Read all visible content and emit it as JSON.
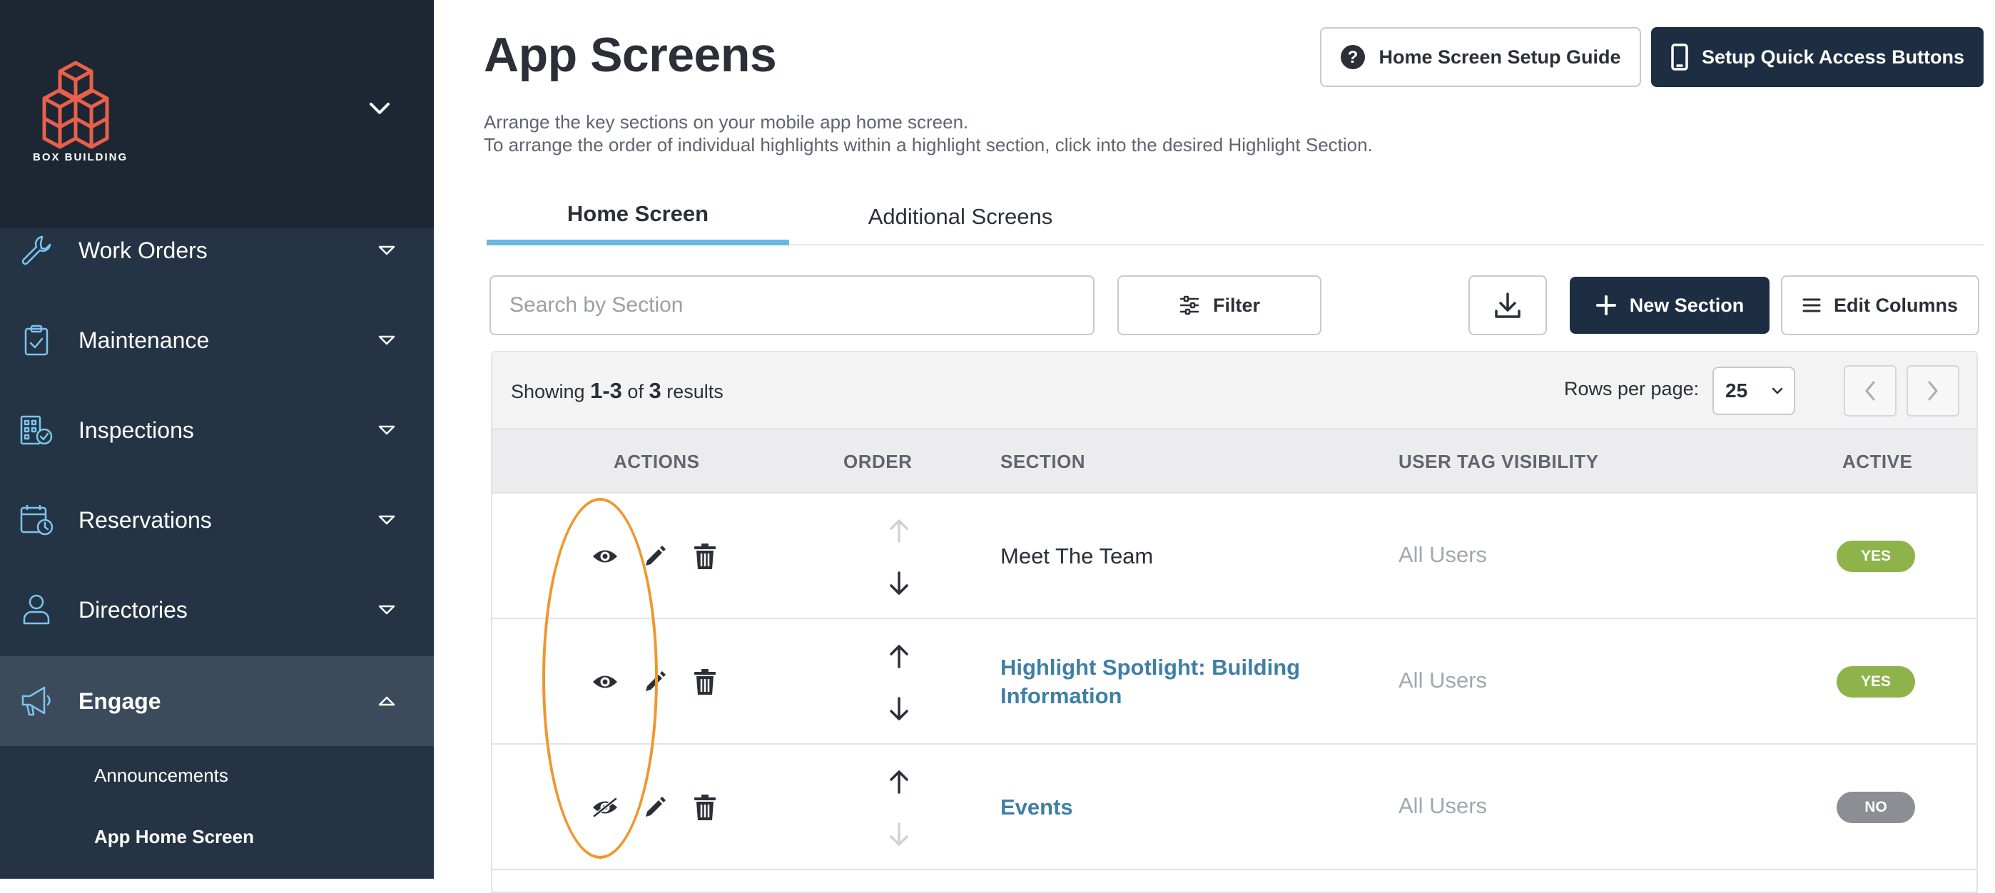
{
  "brand": {
    "name": "BOX BUILDING"
  },
  "sidebar": {
    "items": [
      {
        "label": "Work Orders",
        "icon": "wrench-icon"
      },
      {
        "label": "Maintenance",
        "icon": "clipboard-check-icon"
      },
      {
        "label": "Inspections",
        "icon": "building-check-icon"
      },
      {
        "label": "Reservations",
        "icon": "calendar-clock-icon"
      },
      {
        "label": "Directories",
        "icon": "person-icon"
      },
      {
        "label": "Engage",
        "icon": "megaphone-icon"
      }
    ],
    "subitems": [
      {
        "label": "Announcements"
      },
      {
        "label": "App Home Screen"
      }
    ]
  },
  "header": {
    "title": "App Screens",
    "description_line1": "Arrange the key sections on your mobile app home screen.",
    "description_line2": "To arrange the order of individual highlights within a highlight section, click into the desired Highlight Section.",
    "guide_button": "Home Screen Setup Guide",
    "quick_access_button": "Setup Quick Access Buttons"
  },
  "tabs": [
    {
      "label": "Home Screen"
    },
    {
      "label": "Additional Screens"
    }
  ],
  "toolbar": {
    "search_placeholder": "Search by Section",
    "filter_label": "Filter",
    "new_section_label": "New Section",
    "edit_columns_label": "Edit Columns"
  },
  "table": {
    "showing_prefix": "Showing",
    "showing_range": "1-3",
    "showing_of": "of",
    "showing_total": "3",
    "showing_suffix": "results",
    "rows_per_page_label": "Rows per page:",
    "rows_per_page_value": "25",
    "columns": [
      "ACTIONS",
      "ORDER",
      "SECTION",
      "USER TAG VISIBILITY",
      "ACTIVE"
    ],
    "rows": [
      {
        "section": "Meet The Team",
        "visibility": "All Users",
        "active": "YES",
        "visible": true
      },
      {
        "section_line1": "Highlight Spotlight: Building",
        "section_line2": "Information",
        "visibility": "All Users",
        "active": "YES",
        "visible": true
      },
      {
        "section": "Events",
        "visibility": "All Users",
        "active": "NO",
        "visible": false
      }
    ]
  },
  "colors": {
    "sidebar": "#253445",
    "brand_bg": "#1c2733",
    "primary_dark": "#1d2d42",
    "tab_accent": "#6ab7e3",
    "link": "#3e7fa6",
    "badge_yes": "#8db34a",
    "badge_no": "#8b8e92",
    "logo": "#e8604c",
    "highlight": "#f0962e"
  }
}
